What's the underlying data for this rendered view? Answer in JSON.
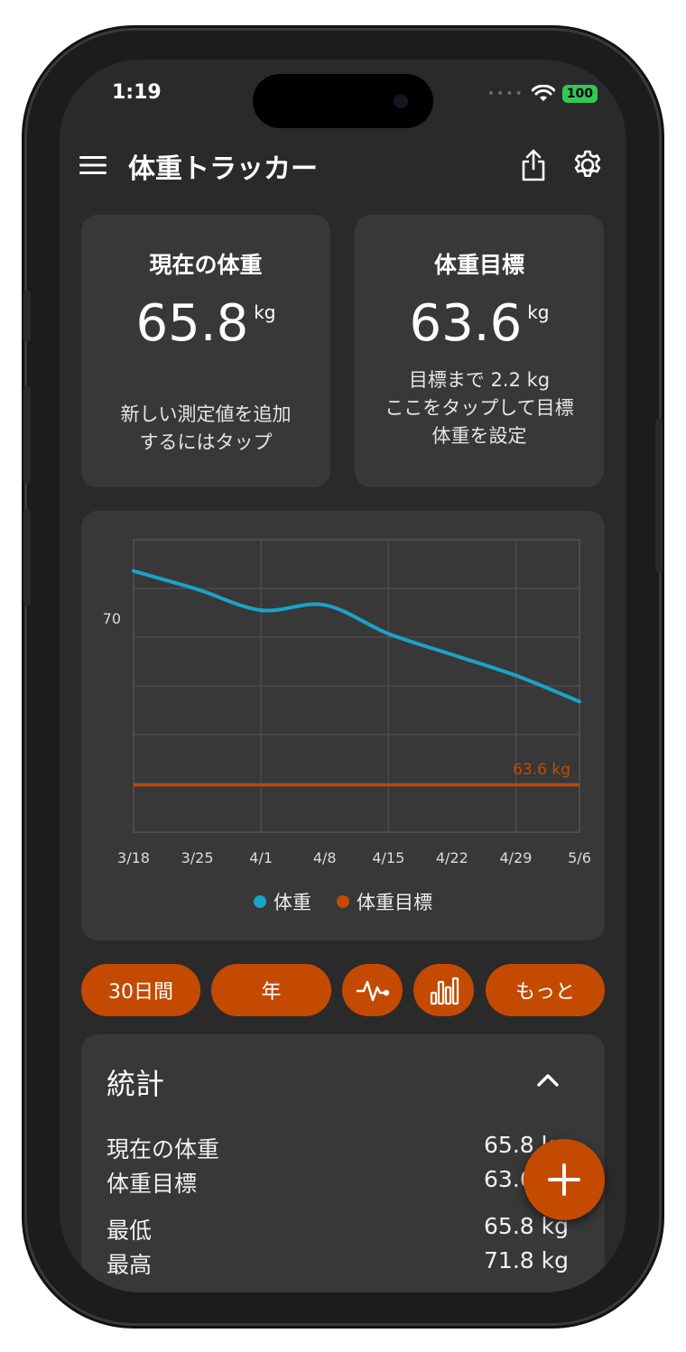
{
  "status_bar": {
    "time": "1:19",
    "battery": "100",
    "signal": "••••"
  },
  "app_bar": {
    "title": "体重トラッカー"
  },
  "current_card": {
    "title": "現在の体重",
    "value": "65.8",
    "unit": "kg",
    "sub_line1": "新しい測定値を追加",
    "sub_line2": "するにはタップ"
  },
  "goal_card": {
    "title": "体重目標",
    "value": "63.6",
    "unit": "kg",
    "sub_line1": "目標まで 2.2 kg",
    "sub_line2": "ここをタップして目標",
    "sub_line3": "体重を設定"
  },
  "chart_data": {
    "type": "line",
    "x": [
      "3/18",
      "3/25",
      "4/1",
      "4/8",
      "4/15",
      "4/22",
      "4/29",
      "5/6"
    ],
    "ytick_labels": [
      "70"
    ],
    "ylim": [
      61.8,
      73
    ],
    "grid": true,
    "legend_position": "bottom",
    "series": [
      {
        "name": "体重",
        "color": "#1aa3c9",
        "values": [
          71.8,
          71.1,
          70.3,
          70.5,
          69.4,
          68.6,
          67.8,
          66.8
        ]
      },
      {
        "name": "体重目標",
        "color": "#c44a00",
        "values": [
          63.6,
          63.6,
          63.6,
          63.6,
          63.6,
          63.6,
          63.6,
          63.6
        ]
      }
    ],
    "annotation": "63.6 kg"
  },
  "chips": {
    "days30": "30日間",
    "year": "年",
    "more": "もっと"
  },
  "stats": {
    "title": "統計",
    "rows": [
      {
        "label": "現在の体重",
        "value": "65.8 kg"
      },
      {
        "label": "体重目標",
        "value": "63.6 kg"
      },
      {
        "label": "最低",
        "value": "65.8 kg"
      },
      {
        "label": "最高",
        "value": "71.8 kg"
      }
    ]
  },
  "colors": {
    "accent": "#c44a00",
    "weight_line": "#1aa3c9",
    "card": "#383838",
    "background": "#2a2a2a"
  },
  "icons": [
    "menu-icon",
    "share-icon",
    "gear-icon",
    "pulse-chart-icon",
    "bar-chart-icon",
    "chevron-up-icon",
    "plus-icon"
  ]
}
